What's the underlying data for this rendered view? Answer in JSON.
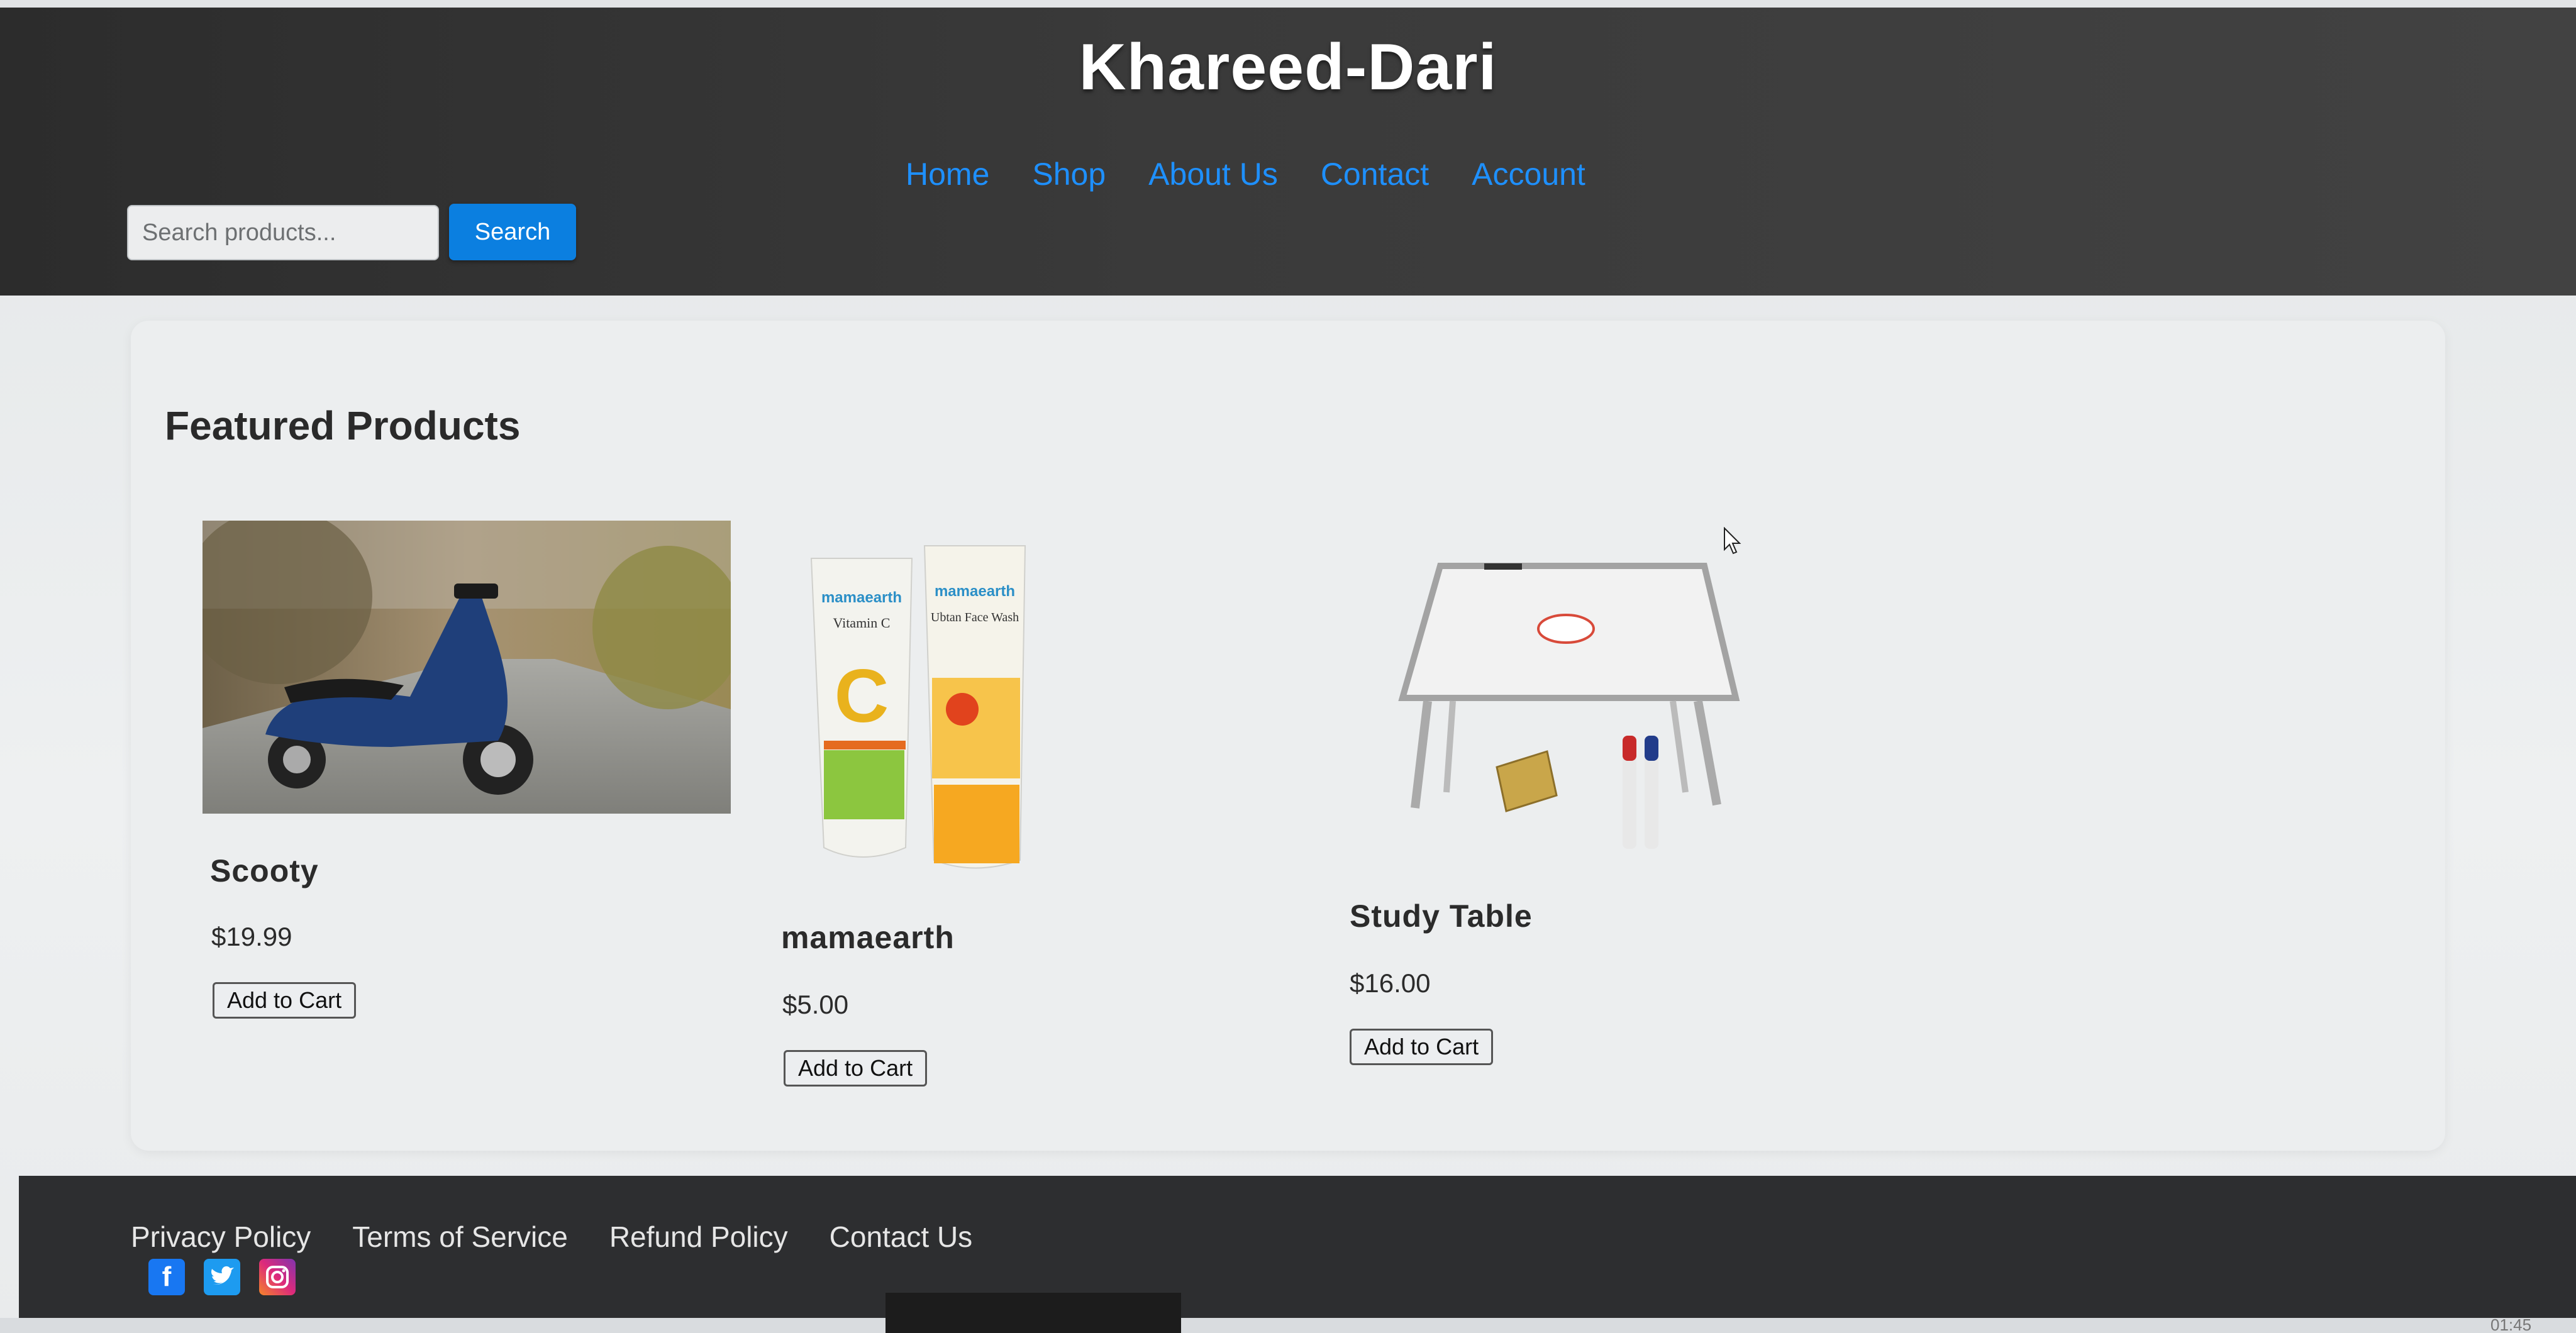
{
  "header": {
    "site_title": "Khareed-Dari",
    "nav": [
      "Home",
      "Shop",
      "About Us",
      "Contact",
      "Account"
    ],
    "search": {
      "placeholder": "Search products...",
      "button_label": "Search"
    }
  },
  "main": {
    "section_title": "Featured Products",
    "products": [
      {
        "name": "Scooty",
        "price": "$19.99",
        "button_label": "Add to Cart",
        "image": "blue-scooter-photo"
      },
      {
        "name": "mamaearth",
        "price": "$5.00",
        "button_label": "Add to Cart",
        "image": "skincare-tubes-photo",
        "image_text": [
          "mamaearth",
          "Vitamin C",
          "Ubtan Face Wash"
        ]
      },
      {
        "name": "Study Table",
        "price": "$16.00",
        "button_label": "Add to Cart",
        "image": "folding-table-photo"
      }
    ]
  },
  "footer": {
    "links": [
      "Privacy Policy",
      "Terms of Service",
      "Refund Policy",
      "Contact Us"
    ],
    "social_icons": [
      "facebook-icon",
      "twitter-icon",
      "instagram-icon"
    ]
  },
  "taskbar": {
    "clock": "01:45"
  },
  "colors": {
    "header_bg": "#333333",
    "nav_link": "#1e90ff",
    "search_button": "#0b7fe0",
    "footer_bg": "#2d2e30"
  }
}
